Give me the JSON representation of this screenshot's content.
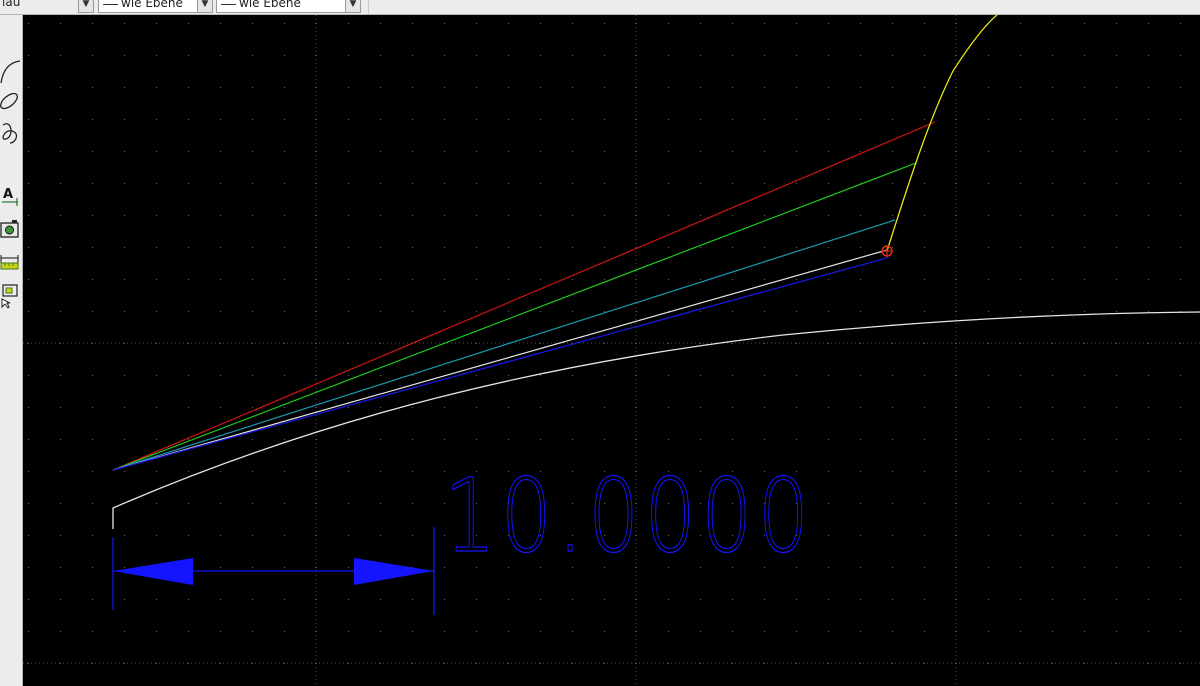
{
  "toolbar": {
    "layer_label": "lau",
    "line_type": "wie Ebene",
    "line_width": "wie Ebene"
  },
  "tools": [
    {
      "name": "arc-tool",
      "icon": "arc-icon"
    },
    {
      "name": "ellipse-tool",
      "icon": "ellipse-icon"
    },
    {
      "name": "spline-tool",
      "icon": "spline-icon"
    },
    {
      "name": "text-tool",
      "icon": "text-icon"
    },
    {
      "name": "image-tool",
      "icon": "camera-icon"
    },
    {
      "name": "dimension-tool",
      "icon": "dimension-icon"
    },
    {
      "name": "block-tool",
      "icon": "block-icon"
    }
  ],
  "drawing": {
    "dimension_text": "10.0000",
    "colors": {
      "background": "#000000",
      "grid": "#6a6a6a",
      "red_line": "#d01414",
      "green_line": "#1ec81e",
      "cyan_line": "#1a9ab4",
      "blue_line": "#1818e0",
      "white_curve": "#e6e6e6",
      "yellow_curve": "#e6e614",
      "dimension": "#1414ff"
    }
  }
}
